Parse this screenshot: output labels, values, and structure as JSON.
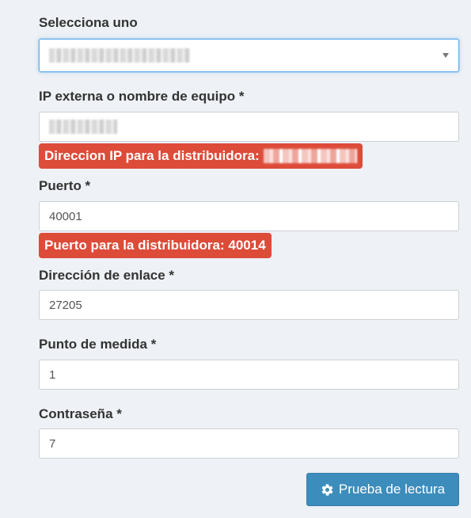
{
  "form": {
    "select": {
      "label": "Selecciona uno",
      "value": "",
      "value_redacted": true
    },
    "ip_field": {
      "label": "IP externa o nombre de equipo *",
      "value": "",
      "value_redacted": true
    },
    "ip_alert": {
      "text": "Direccion IP para la distribuidora:",
      "value_redacted": true
    },
    "port_field": {
      "label": "Puerto *",
      "value": "40001"
    },
    "port_alert": {
      "text": "Puerto para la distribuidora: 40014"
    },
    "link_address_field": {
      "label": "Dirección de enlace *",
      "value": "27205"
    },
    "measure_point_field": {
      "label": "Punto de medida *",
      "value": "1"
    },
    "password_field": {
      "label": "Contraseña *",
      "value": "7"
    },
    "submit_button": {
      "label": "Prueba de lectura",
      "icon": "gear-icon"
    }
  },
  "colors": {
    "background": "#eef1f5",
    "alert": "#dd4b39",
    "primary_button": "#3c8dbc",
    "focus_border": "#66afe9"
  }
}
